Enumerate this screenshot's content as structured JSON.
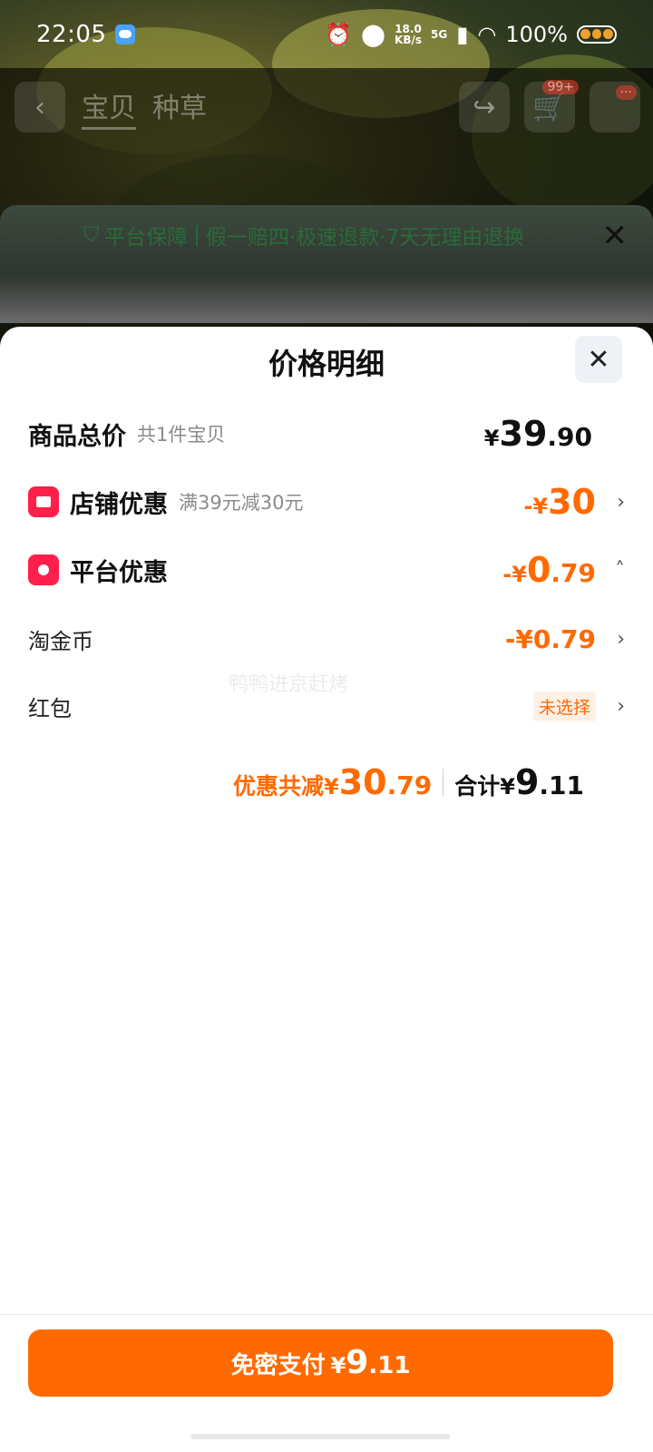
{
  "status_bar": {
    "time": "22:05",
    "speed_value": "18.0",
    "speed_unit": "KB/s",
    "network": "5G",
    "battery": "100%"
  },
  "product_header": {
    "tabs": [
      "宝贝",
      "种草"
    ],
    "cart_badge": "99+",
    "more_badge": "···"
  },
  "guarantee": {
    "title": "平台保障",
    "text": "假一赔四·极速退款·7天无理由退换"
  },
  "sheet": {
    "title": "价格明细"
  },
  "rows": {
    "total": {
      "label": "商品总价",
      "sub": "共1件宝贝",
      "yen": "¥",
      "int": "39",
      "dec": ".90"
    },
    "shop": {
      "label": "店铺优惠",
      "sub": "满39元减30元",
      "prefix": "-¥",
      "int": "30",
      "dec": ""
    },
    "platform": {
      "label": "平台优惠",
      "prefix": "-¥",
      "int": "0",
      "dec": ".79"
    },
    "coins": {
      "label": "淘金币",
      "value": "-¥0.79"
    },
    "redpacket": {
      "label": "红包",
      "value": "未选择"
    }
  },
  "watermark": "鸭鸭进京赶烤",
  "summary": {
    "discount_label": "优惠共减",
    "discount_yen": "¥",
    "discount_int": "30",
    "discount_dec": ".79",
    "total_label": "合计",
    "total_yen": "¥",
    "total_int": "9",
    "total_dec": ".11"
  },
  "pay_button": {
    "label": "免密支付",
    "yen": "¥",
    "int": "9",
    "dec": ".11"
  },
  "colors": {
    "accent": "#ff6a00",
    "icon_red": "#ff1f4b"
  }
}
